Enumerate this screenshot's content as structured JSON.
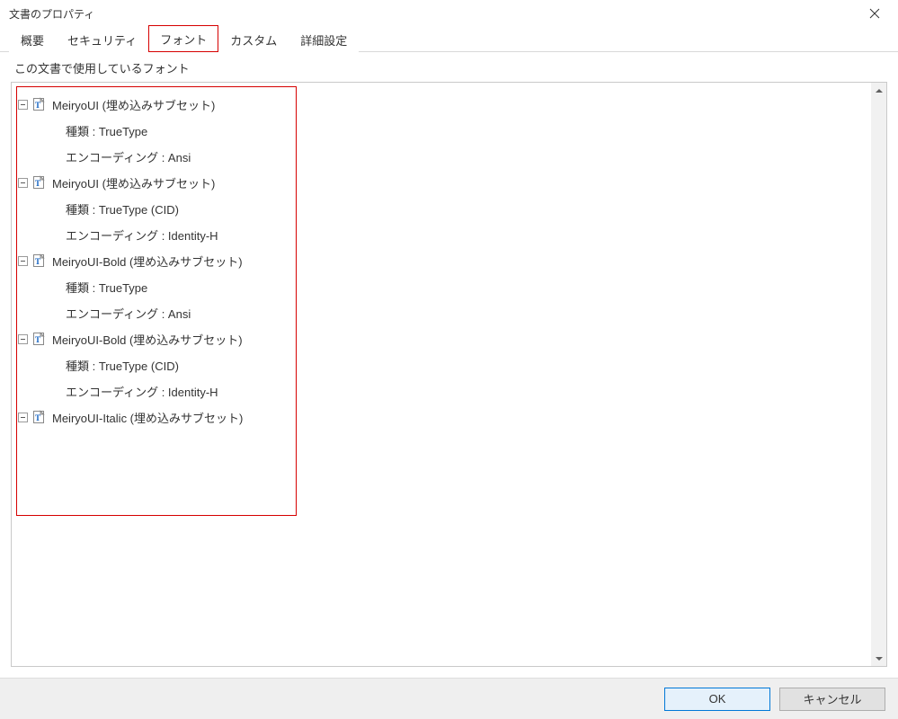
{
  "title": "文書のプロパティ",
  "tabs": {
    "summary": "概要",
    "security": "セキュリティ",
    "fonts": "フォント",
    "custom": "カスタム",
    "advanced": "詳細設定"
  },
  "group_label": "この文書で使用しているフォント",
  "type_label": "種類",
  "encoding_label": "エンコーディング",
  "fonts_list": [
    {
      "name": "MeiryoUI (埋め込みサブセット)",
      "type": "TrueType",
      "encoding": "Ansi"
    },
    {
      "name": "MeiryoUI (埋め込みサブセット)",
      "type": "TrueType (CID)",
      "encoding": "Identity-H"
    },
    {
      "name": "MeiryoUI-Bold (埋め込みサブセット)",
      "type": "TrueType",
      "encoding": "Ansi"
    },
    {
      "name": "MeiryoUI-Bold (埋め込みサブセット)",
      "type": "TrueType (CID)",
      "encoding": "Identity-H"
    },
    {
      "name": "MeiryoUI-Italic (埋め込みサブセット)",
      "type": "",
      "encoding": ""
    }
  ],
  "buttons": {
    "ok": "OK",
    "cancel": "キャンセル"
  }
}
